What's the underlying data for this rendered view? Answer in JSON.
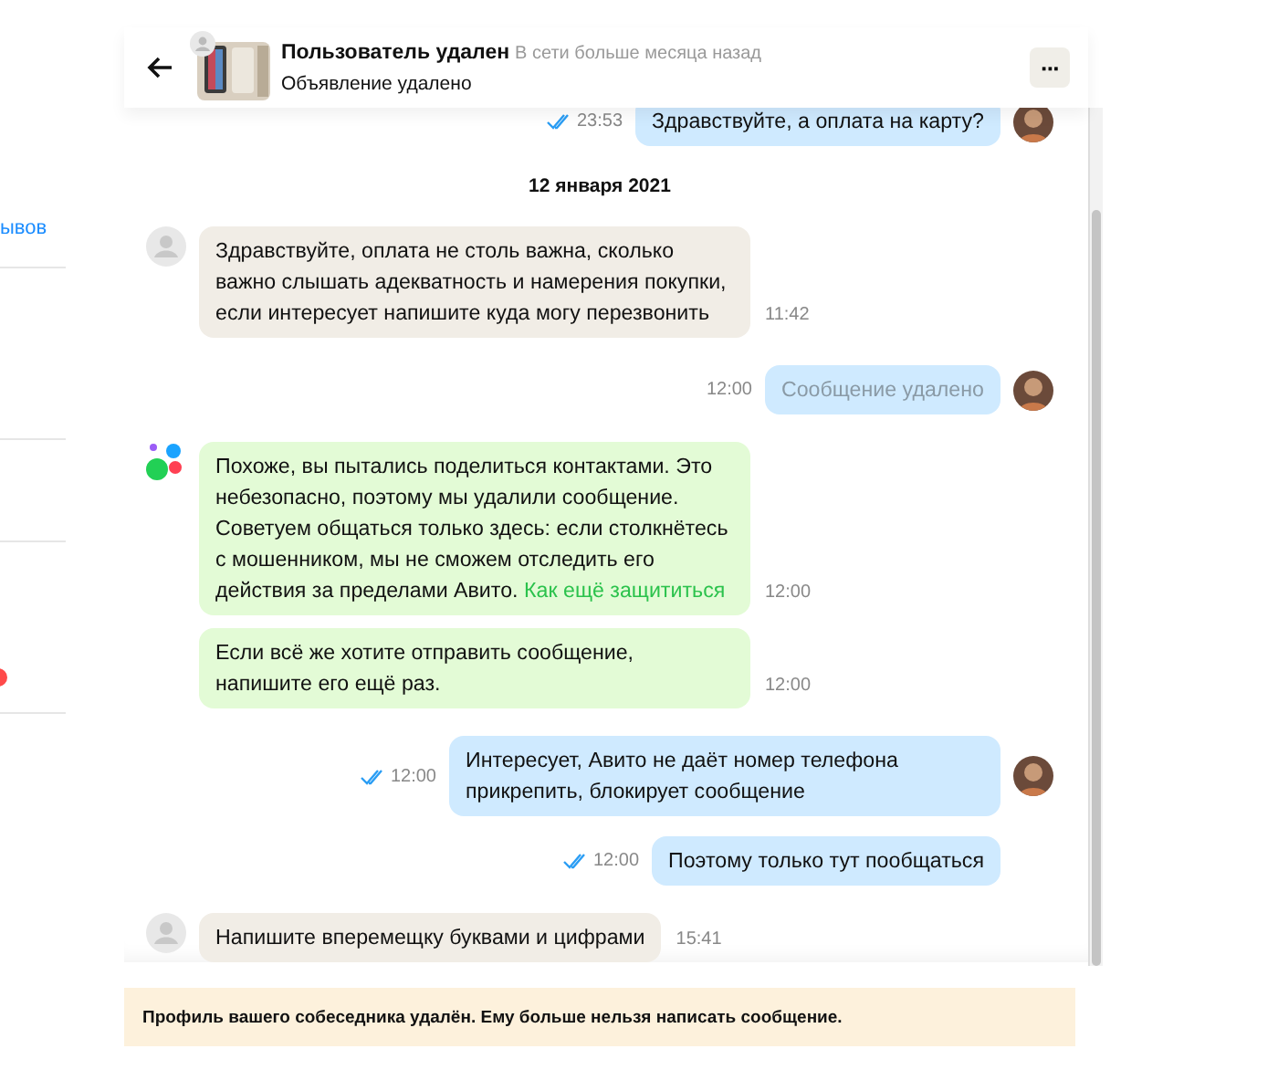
{
  "sidebar": {
    "link": "ывов"
  },
  "header": {
    "title": "Пользователь удален",
    "status": "В сети больше месяца назад",
    "subtitle": "Объявление удалено",
    "menu": "···"
  },
  "messages": [
    {
      "kind": "outgoing",
      "text": "Здравствуйте, а оплата на карту?",
      "time": "23:53",
      "read": true,
      "deleted": false,
      "avatar": true
    },
    {
      "kind": "date",
      "text": "12 января 2021"
    },
    {
      "kind": "incoming",
      "text": "Здравствуйте, оплата не столь важна, сколько важно слышать адекватность и намерения покупки, если интересует напишите куда могу перезвонить",
      "time": "11:42",
      "avatar": true
    },
    {
      "kind": "outgoing",
      "text": "Сообщение удалено",
      "time": "12:00",
      "read": false,
      "deleted": true,
      "avatar": true
    },
    {
      "kind": "system",
      "text": "Похоже, вы пытались поделиться контактами. Это небезопасно, поэтому мы удалили сообщение. Советуем общаться только здесь: если столкнётесь с мошенником, мы не сможем отследить его действия за пределами Авито.",
      "link": "Как ещё защититься",
      "time": "12:00",
      "avatar": true
    },
    {
      "kind": "system",
      "text": "Если всё же хотите отправить сообщение, напишите его ещё раз.",
      "time": "12:00",
      "avatar": false
    },
    {
      "kind": "outgoing",
      "text": "Интересует, Авито не даёт номер телефона прикрепить, блокирует сообщение",
      "time": "12:00",
      "read": true,
      "deleted": false,
      "avatar": true
    },
    {
      "kind": "outgoing",
      "text": "Поэтому только тут пообщаться",
      "time": "12:00",
      "read": true,
      "deleted": false,
      "avatar": false
    },
    {
      "kind": "incoming",
      "text": "Напишите вперемещку буквами и цифрами",
      "time": "15:41",
      "avatar": true
    }
  ],
  "notice": "Профиль вашего собеседника удалён. Ему больше нельзя написать сообщение."
}
